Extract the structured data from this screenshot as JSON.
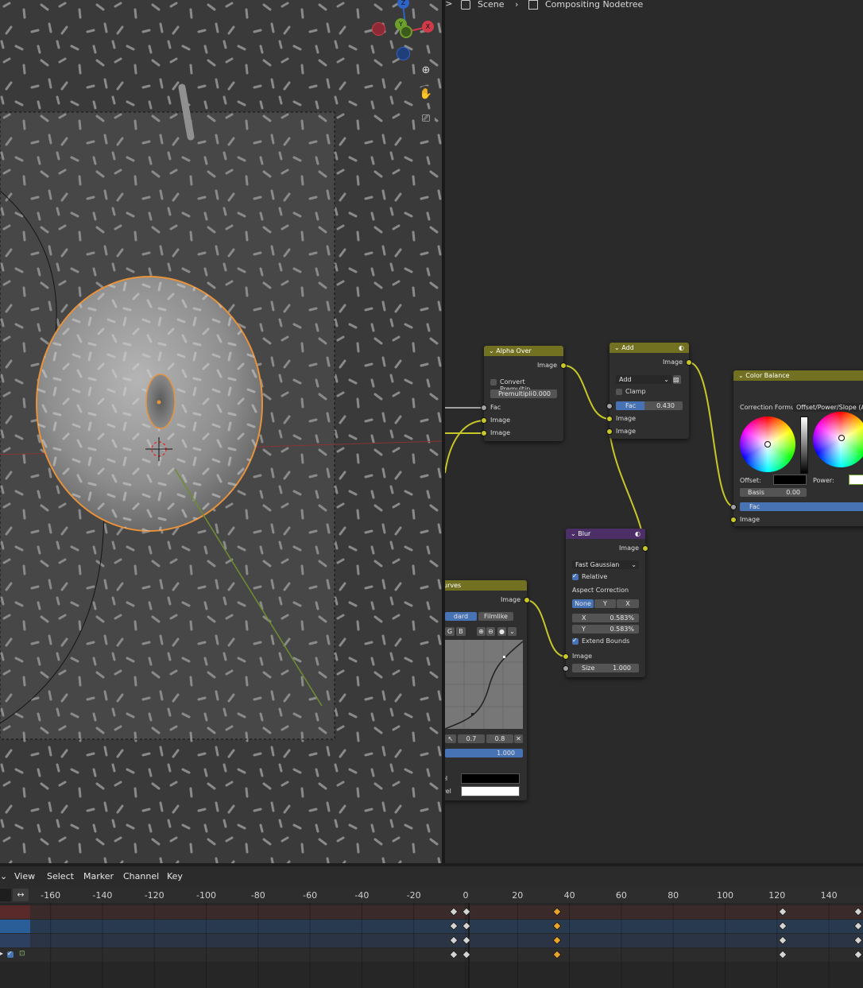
{
  "breadcrumb": {
    "scene": "Scene",
    "nodetree": "Compositing Nodetree"
  },
  "nav_icons": [
    "zoom-icon",
    "hand-icon",
    "camera-icon"
  ],
  "gizmo": {
    "z": "Z",
    "y": "Y",
    "x": "X"
  },
  "nodes": {
    "alpha_over": {
      "title": "Alpha Over",
      "output": "Image",
      "convert_label": "Convert Premultip...",
      "premul_label": "Premultipli",
      "premul_value": "0.000",
      "in_fac": "Fac",
      "in_image1": "Image",
      "in_image2": "Image"
    },
    "add": {
      "title": "Add",
      "output": "Image",
      "blend_mode": "Add",
      "clamp_label": "Clamp",
      "fac_label": "Fac",
      "fac_value": "0.430",
      "in_image1": "Image",
      "in_image2": "Image"
    },
    "color_balance": {
      "title": "Color Balance",
      "correction_label": "Correction Formu",
      "correction_value": "Offset/Power/Slope (ASC",
      "offset_label": "Offset:",
      "power_label": "Power:",
      "basis_label": "Basis",
      "basis_value": "0.00",
      "in_fac": "Fac",
      "in_image": "Image"
    },
    "blur": {
      "title": "Blur",
      "output": "Image",
      "filter": "Fast Gaussian",
      "relative_label": "Relative",
      "aspect_label": "Aspect Correction",
      "aspect_options": [
        "None",
        "Y",
        "X"
      ],
      "x_label": "X",
      "x_value": "0.583%",
      "y_label": "Y",
      "y_value": "0.583%",
      "extend_label": "Extend Bounds",
      "in_image": "Image",
      "size_label": "Size",
      "size_value": "1.000"
    },
    "curves": {
      "title": "urves",
      "output": "Image",
      "tab1": "dard",
      "tab2": "Filmlike",
      "ch_g": "G",
      "ch_b": "B",
      "v1": "0.7",
      "v2": "0.8",
      "fac_value": "1.000",
      "black_label": "el",
      "white_label": "vel"
    }
  },
  "timeline": {
    "menu": [
      "View",
      "Select",
      "Marker",
      "Channel",
      "Key"
    ],
    "ruler": [
      -160,
      -140,
      -120,
      -100,
      -80,
      -60,
      -40,
      -20,
      0,
      20,
      40,
      60,
      80,
      100,
      120,
      140
    ],
    "current_frame": 0
  }
}
